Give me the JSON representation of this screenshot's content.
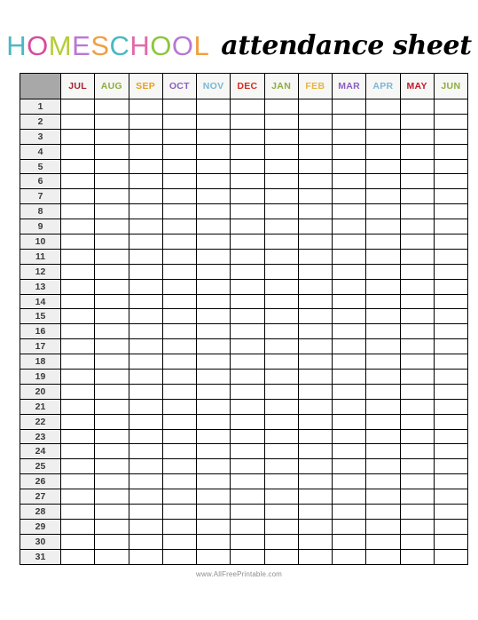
{
  "title": {
    "word_letters": [
      {
        "char": "H",
        "color": "#4bb8c4"
      },
      {
        "char": "O",
        "color": "#d84b9e"
      },
      {
        "char": "M",
        "color": "#b5cc3b"
      },
      {
        "char": "E",
        "color": "#b978d4"
      },
      {
        "char": "S",
        "color": "#f0a040"
      },
      {
        "char": "C",
        "color": "#4bb8c4"
      },
      {
        "char": "H",
        "color": "#e06aa8"
      },
      {
        "char": "O",
        "color": "#8cc63f"
      },
      {
        "char": "O",
        "color": "#b978d4"
      },
      {
        "char": "L",
        "color": "#f0a040"
      }
    ],
    "word_text": "HOMESCHOOL",
    "script_text": "attendance sheet"
  },
  "table": {
    "corner_label": "",
    "months": [
      {
        "label": "JUL",
        "color": "#a82232"
      },
      {
        "label": "AUG",
        "color": "#8cae3e"
      },
      {
        "label": "SEP",
        "color": "#e8a020"
      },
      {
        "label": "OCT",
        "color": "#8a5fc0"
      },
      {
        "label": "NOV",
        "color": "#7bb6d8"
      },
      {
        "label": "DEC",
        "color": "#d62b1f"
      },
      {
        "label": "JAN",
        "color": "#8cae3e"
      },
      {
        "label": "FEB",
        "color": "#e8b43c"
      },
      {
        "label": "MAR",
        "color": "#8a5fc0"
      },
      {
        "label": "APR",
        "color": "#7bb6d8"
      },
      {
        "label": "MAY",
        "color": "#c0192b"
      },
      {
        "label": "JUN",
        "color": "#8cae3e"
      }
    ],
    "day_numbers": [
      "1",
      "2",
      "3",
      "4",
      "5",
      "6",
      "7",
      "8",
      "9",
      "10",
      "11",
      "12",
      "13",
      "14",
      "15",
      "16",
      "17",
      "18",
      "19",
      "20",
      "21",
      "22",
      "23",
      "24",
      "25",
      "26",
      "27",
      "28",
      "29",
      "30",
      "31"
    ],
    "cell_values": []
  },
  "footer": {
    "text": "www.AllFreePrintable.com"
  },
  "colors": {
    "corner_gray": "#a8a8a8",
    "rownum_gray": "#efefef",
    "header_bg": "#f7f7f5",
    "grid_line": "#000000",
    "footer_text": "#8d8d8d"
  }
}
